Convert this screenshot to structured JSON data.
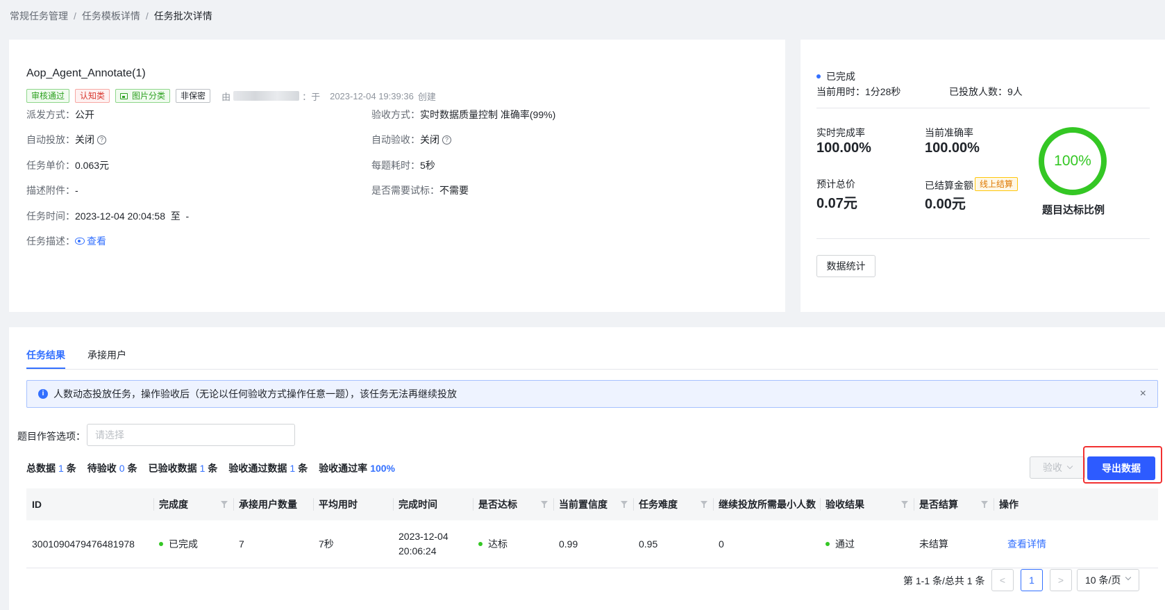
{
  "breadcrumb": {
    "items": [
      "常规任务管理",
      "任务模板详情"
    ],
    "current": "任务批次详情",
    "sep": "/"
  },
  "info": {
    "title": "Aop_Agent_Annotate(1)",
    "tags": {
      "audit": "审核通过",
      "cognitive": "认知类",
      "image": "图片分类",
      "secret": "非保密"
    },
    "creator": {
      "prefix": "由",
      "suffix": "：于",
      "date": "2023-12-04 19:39:36",
      "action": "创建"
    },
    "fields": {
      "dispatch_lbl": "派发方式：",
      "dispatch_val": "公开",
      "check_lbl": "验收方式：",
      "check_val": "实时数据质量控制 准确率(99%)",
      "autopub_lbl": "自动投放：",
      "autopub_val": "关闭",
      "autocheck_lbl": "自动验收：",
      "autocheck_val": "关闭",
      "price_lbl": "任务单价：",
      "price_val": "0.063元",
      "time_per_lbl": "每题耗时：",
      "time_per_val": "5秒",
      "attach_lbl": "描述附件：",
      "attach_val": "-",
      "trial_lbl": "是否需要试标：",
      "trial_val": "不需要",
      "tasktime_lbl": "任务时间：",
      "tasktime_val": "2023-12-04 20:04:58  至  -",
      "desc_lbl": "任务描述：",
      "desc_link": "查看"
    },
    "help_glyph": "?"
  },
  "stats": {
    "status": "已完成",
    "elapsed": "当前用时：1分28秒",
    "launched": "已投放人数：9人",
    "rate_lbl": "实时完成率",
    "rate_val": "100.00%",
    "acc_lbl": "当前准确率",
    "acc_val": "100.00%",
    "total_lbl": "预计总价",
    "total_val": "0.07元",
    "settled_lbl": "已结算金额",
    "settled_val": "0.00元",
    "settled_tag": "线上结算",
    "ring_val": "100%",
    "ring_pct": 1.0,
    "ring_lbl": "题目达标比例",
    "stats_btn": "数据统计"
  },
  "results": {
    "tabs": [
      "任务结果",
      "承接用户"
    ],
    "alert": "人数动态投放任务，操作验收后（无论以任何验收方式操作任意一题），该任务无法再继续投放",
    "info_glyph": "i",
    "close_glyph": "×",
    "filter_lbl": "题目作答选项：",
    "filter_placeholder": "请选择",
    "summary": {
      "total_lbl": "总数据",
      "total": "1",
      "unit": "条",
      "pending_lbl": "待验收",
      "pending": "0",
      "checked_lbl": "已验收数据",
      "checked": "1",
      "passed_lbl": "验收通过数据",
      "passed": "1",
      "rate_lbl": "验收通过率",
      "rate": "100%"
    },
    "check_btn": "验收",
    "export_btn": "导出数据",
    "columns": [
      "ID",
      "完成度",
      "承接用户数量",
      "平均用时",
      "完成时间",
      "是否达标",
      "当前置信度",
      "任务难度",
      "继续投放所需最小人数",
      "验收结果",
      "是否结算",
      "操作"
    ],
    "rows": [
      {
        "id": "3001090479476481978",
        "completion": "已完成",
        "users": "7",
        "avg": "7秒",
        "time1": "2023-12-04",
        "time2": "20:06:24",
        "standard": "达标",
        "confidence": "0.99",
        "difficulty": "0.95",
        "min_users": "0",
        "check_result": "通过",
        "settled": "未结算",
        "action": "查看详情"
      }
    ],
    "pager": {
      "summary": "第 1-1 条/总共 1 条",
      "prev": "<",
      "page": "1",
      "next": ">",
      "size": "10 条/页"
    }
  },
  "colors": {
    "primary": "#3370ff",
    "success": "#34c724",
    "danger": "#f23131"
  }
}
